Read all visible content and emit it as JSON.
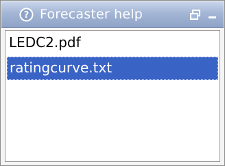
{
  "window": {
    "title": "Forecaster help",
    "icons": {
      "help": "help-circle-icon",
      "restore": "restore-window-icon",
      "minimize": "minimize-icon"
    }
  },
  "file_list": {
    "items": [
      {
        "label": "LEDC2.pdf",
        "selected": false
      },
      {
        "label": "ratingcurve.txt",
        "selected": true
      }
    ],
    "selection_color": "#3a63c6"
  },
  "colors": {
    "titlebar_top": "#c9d6ea",
    "titlebar_bottom": "#8ea3c7",
    "title_text": "#ffffff",
    "selection_text": "#ffffff"
  }
}
